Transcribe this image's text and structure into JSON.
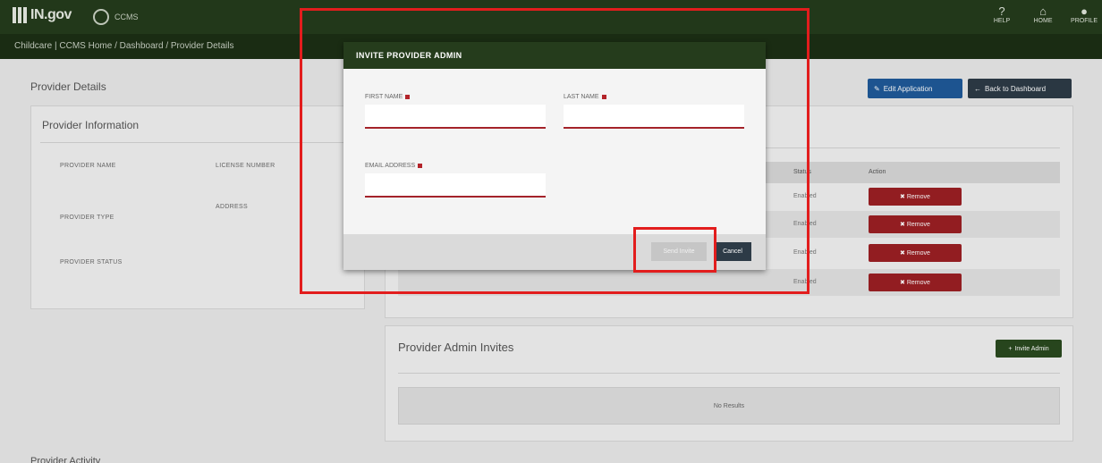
{
  "app": {
    "logo": "IN.gov",
    "site_name": "CCMS"
  },
  "top_actions": [
    {
      "icon": "help-icon",
      "glyph": "?",
      "label": "HELP"
    },
    {
      "icon": "home-icon",
      "glyph": "⌂",
      "label": "HOME"
    },
    {
      "icon": "profile-icon",
      "glyph": "●",
      "label": "PROFILE"
    }
  ],
  "breadcrumb": "Childcare | CCMS Home / Dashboard / Provider Details",
  "page": {
    "title": "Provider Details",
    "edit_button": "Edit Application",
    "back_button": "Back to Dashboard"
  },
  "provider_info": {
    "title": "Provider Information",
    "labels": [
      "PROVIDER NAME",
      "LICENSE NUMBER",
      "PROVIDER TYPE",
      "ADDRESS",
      "PROVIDER STATUS"
    ]
  },
  "admins_table": {
    "columns": [
      "Status",
      "Action"
    ],
    "rows": [
      {
        "status": "Enabled",
        "action": "Remove"
      },
      {
        "status": "Enabled",
        "action": "Remove"
      },
      {
        "status": "Enabled",
        "action": "Remove"
      },
      {
        "status": "Enabled",
        "action": "Remove"
      }
    ]
  },
  "invites": {
    "title": "Provider Admin Invites",
    "invite_button": "Invite Admin",
    "empty_text": "No Results"
  },
  "bottom_section": "Provider Activity",
  "modal": {
    "title": "INVITE PROVIDER ADMIN",
    "first_name_label": "FIRST NAME",
    "last_name_label": "LAST NAME",
    "email_label": "EMAIL ADDRESS",
    "first_name_value": "",
    "last_name_value": "",
    "email_value": "",
    "send_button": "Send Invite",
    "cancel_button": "Cancel"
  },
  "colors": {
    "header_green": "#253c1c",
    "required_red": "#b3242a",
    "remove_red": "#9c1f24",
    "edit_blue": "#1f5a99",
    "highlight_red": "#e21d1d"
  }
}
